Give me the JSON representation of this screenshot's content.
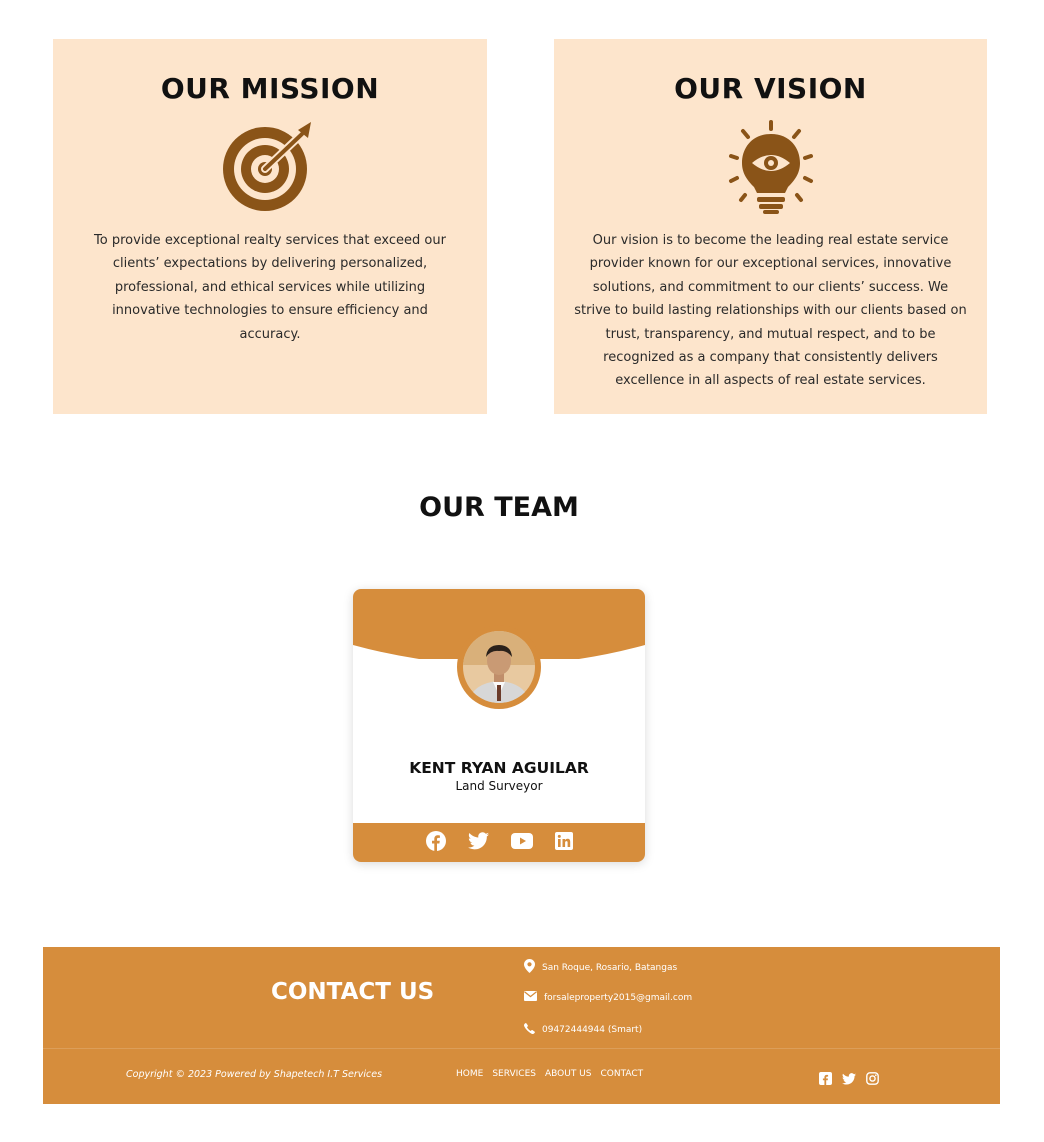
{
  "mission": {
    "title": "OUR MISSION",
    "icon": "target-icon",
    "text": "To provide exceptional realty services that exceed our clients’ expectations by delivering personalized, professional, and ethical services while utilizing innovative technologies to ensure efficiency and accuracy."
  },
  "vision": {
    "title": "OUR VISION",
    "icon": "lightbulb-eye-icon",
    "text": "Our vision is to become the leading real estate service provider known for our exceptional services, innovative solutions, and commitment to our clients’ success. We strive to build lasting relationships with our clients based on trust, transparency, and mutual respect, and to be recognized as a company that consistently delivers excellence in all aspects of real estate services."
  },
  "team": {
    "title": "OUR TEAM",
    "members": [
      {
        "name": "KENT RYAN AGUILAR",
        "role": "Land Surveyor",
        "social": [
          "facebook-icon",
          "twitter-icon",
          "youtube-icon",
          "linkedin-icon"
        ]
      }
    ]
  },
  "footer": {
    "contact_title": "CONTACT US",
    "address": "San Roque, Rosario, Batangas",
    "email": "forsaleproperty2015@gmail.com",
    "phone": "09472444944 (Smart)",
    "copyright": "Copyright © 2023 Powered by Shapetech I.T Services",
    "nav": [
      "HOME",
      "SERVICES",
      "ABOUT US",
      "CONTACT"
    ],
    "social": [
      "facebook-square-icon",
      "twitter-icon",
      "instagram-icon"
    ]
  },
  "colors": {
    "accent": "#d68d3c",
    "icon_brown": "#8a5418",
    "card_bg": "#fde5cc"
  }
}
